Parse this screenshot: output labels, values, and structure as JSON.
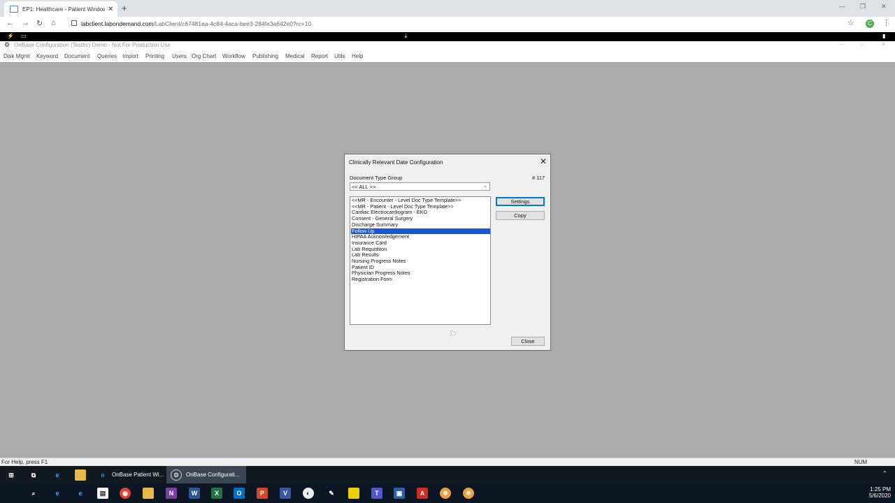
{
  "browser": {
    "tab_title": "EP1: Healthcare - Patient Window",
    "url_host": "labclient.labondemand.com",
    "url_path": "/LabClient/c67481ea-4c84-4aca-bee3-284fe3a642e0?rc=10",
    "profile_initial": "C"
  },
  "app": {
    "title": "OnBase Configuration (Testhc) Demo - Not For Production Use",
    "menu": [
      "Disk Mgmt",
      "Keyword",
      "Document",
      "Queries",
      "Import",
      "Printing",
      "Users",
      "Org Chart",
      "Workflow",
      "Publishing",
      "Medical",
      "Report",
      "Utils",
      "Help"
    ]
  },
  "dialog": {
    "title": "Clinically Relevant Date Configuration",
    "group_label": "Document Type Group",
    "doc_count": "# 117",
    "group_value": "<< ALL >>",
    "doc_types": [
      "<<MR - Encounter - Level Doc Type Template>>",
      "<<MR - Patient - Level Doc Type Template>>",
      "Cardiac Electrocardiogram - EKG",
      "Consent - General Surgery",
      "Discharge Summary",
      "Follow Up",
      "HIPAA Acknowledgement",
      "Insurance Card",
      "Lab Requisition",
      "Lab Results",
      "Nursing Progress Notes",
      "Patient ID",
      "Physician Progress Notes",
      "Registration Form"
    ],
    "selected_index": 5,
    "settings_label": "Settings",
    "copy_label": "Copy",
    "close_label": "Close"
  },
  "status": {
    "help_text": "For Help, press F1",
    "num": "NUM"
  },
  "taskbar_remote": {
    "apps": [
      "OnBase Patient Wi...",
      "OnBase Configurati..."
    ],
    "time": "1:25 PM",
    "date": "5/6/2020"
  },
  "colors": {
    "selection": "#1a56d6",
    "workspace": "#ababab",
    "taskbar": "#0f1b2e"
  }
}
